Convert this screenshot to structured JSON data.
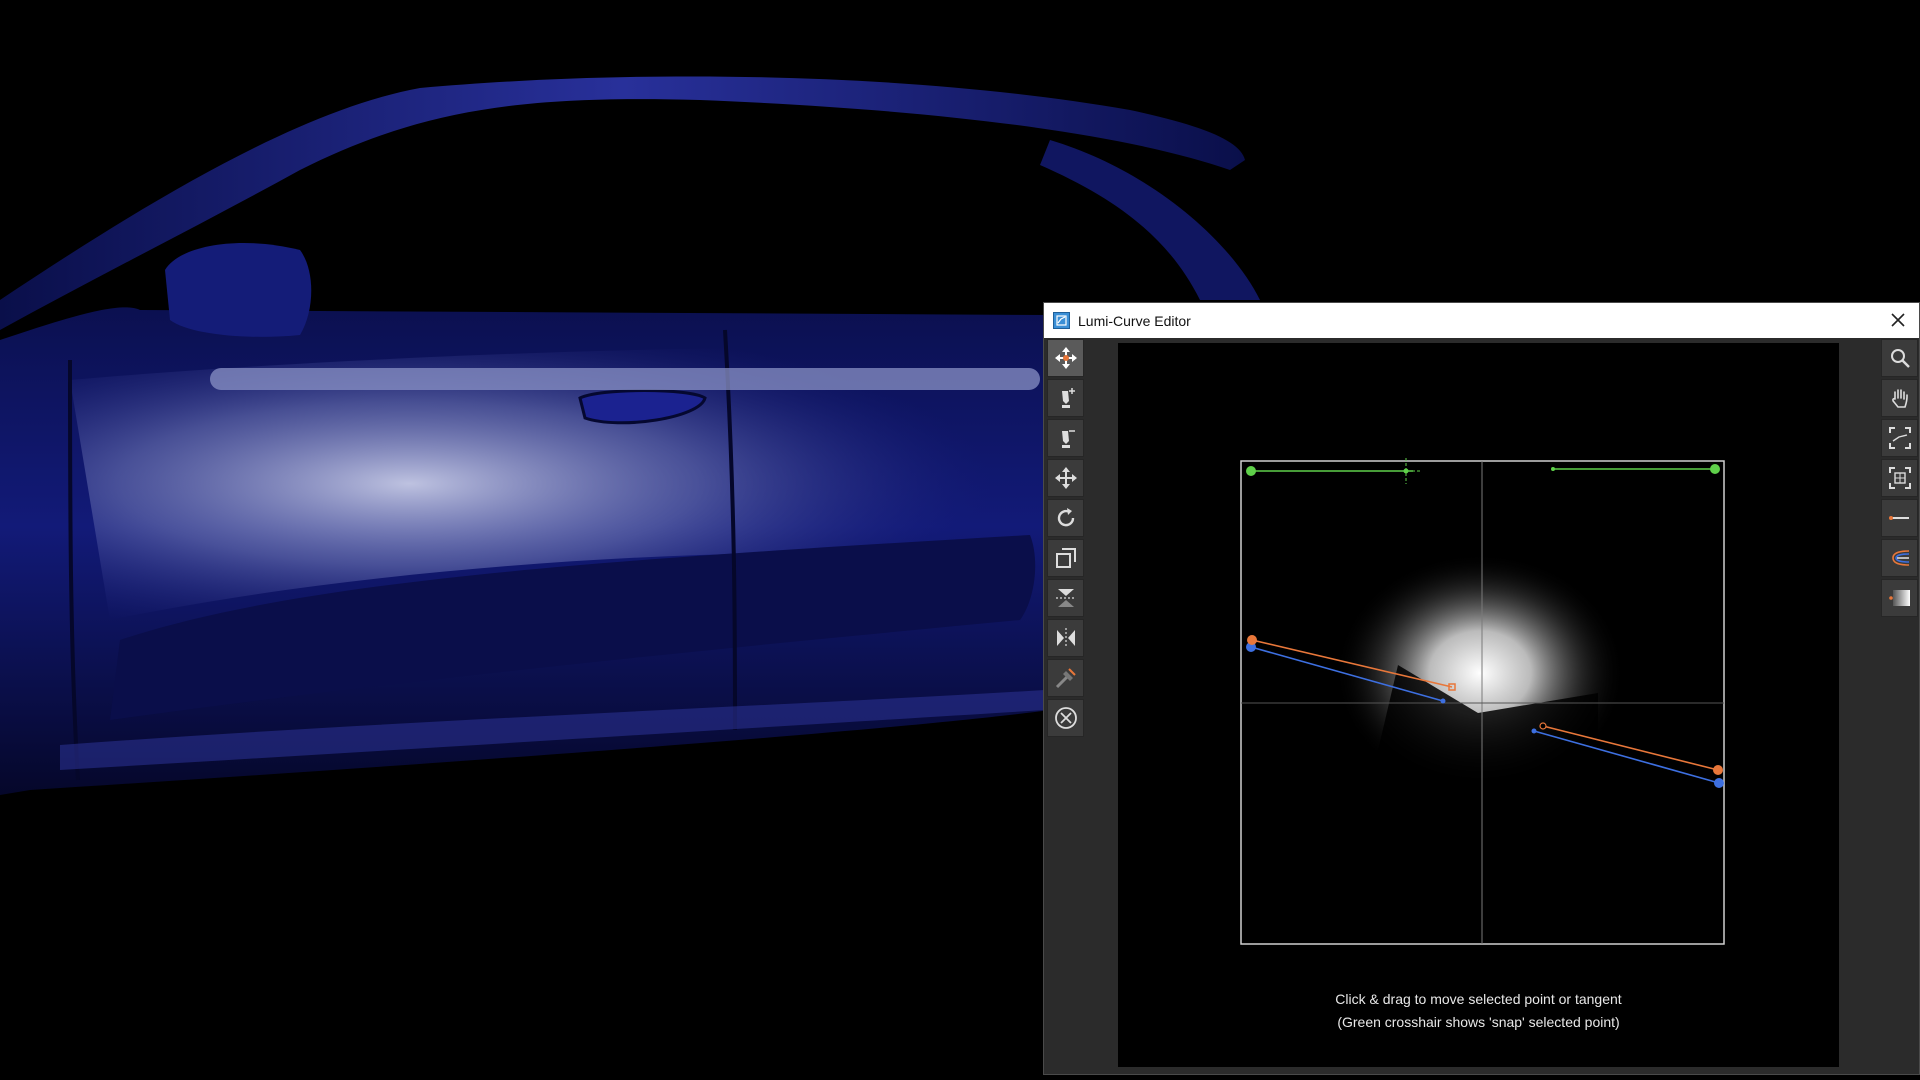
{
  "window": {
    "title": "Lumi-Curve Editor",
    "close_label": "×"
  },
  "left_tools": [
    {
      "icon": "move-point-icon",
      "active": true
    },
    {
      "icon": "add-point-pen-icon",
      "active": false
    },
    {
      "icon": "remove-point-pen-icon",
      "active": false
    },
    {
      "icon": "move-all-icon",
      "active": false
    },
    {
      "icon": "rotate-icon",
      "active": false
    },
    {
      "icon": "scale-icon",
      "active": false
    },
    {
      "icon": "flip-vertical-icon",
      "active": false
    },
    {
      "icon": "flip-horizontal-icon",
      "active": false
    },
    {
      "icon": "smooth-tangent-icon",
      "active": false
    },
    {
      "icon": "delete-point-icon",
      "active": false
    }
  ],
  "right_tools": [
    {
      "icon": "zoom-icon"
    },
    {
      "icon": "pan-hand-icon"
    },
    {
      "icon": "fit-view-icon"
    },
    {
      "icon": "frame-selection-icon"
    },
    {
      "icon": "single-curve-icon"
    },
    {
      "icon": "multi-curve-icon"
    },
    {
      "icon": "gradient-preview-icon"
    }
  ],
  "hint": {
    "line1": "Click & drag to move selected point or tangent",
    "line2": "(Green crosshair shows 'snap' selected point)"
  },
  "colors": {
    "car_body": "#0d1260",
    "curve_orange": "#e8773a",
    "curve_blue": "#3d6fe0",
    "curve_green": "#5fd04a"
  }
}
